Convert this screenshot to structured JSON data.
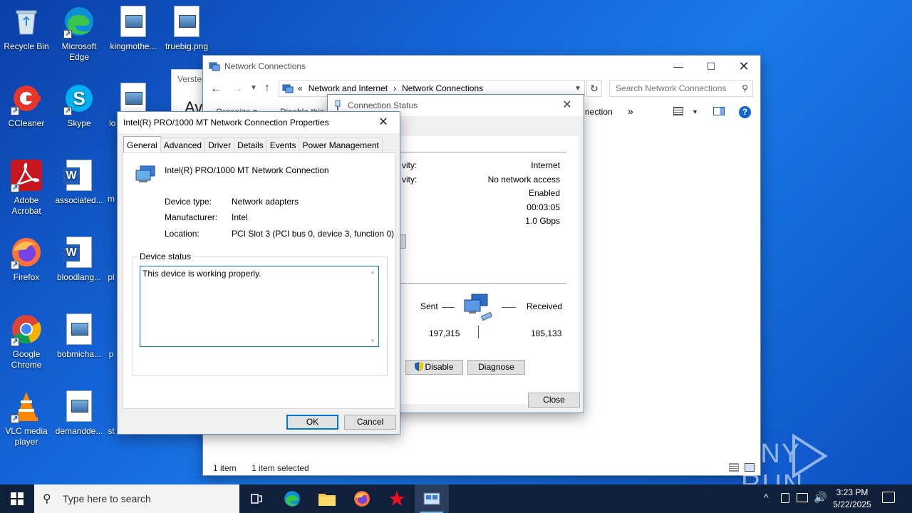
{
  "desktop": {
    "icons": [
      {
        "label": "Recycle Bin"
      },
      {
        "label": "Microsoft Edge"
      },
      {
        "label": "kingmothe..."
      },
      {
        "label": "truebig.png"
      },
      {
        "label": "CCleaner"
      },
      {
        "label": "Skype"
      },
      {
        "label": "lo"
      },
      {
        "label": "Adobe Acrobat"
      },
      {
        "label": "associated..."
      },
      {
        "label": "m"
      },
      {
        "label": "Firefox"
      },
      {
        "label": "bloodlang..."
      },
      {
        "label": "pl"
      },
      {
        "label": "Google Chrome"
      },
      {
        "label": "bobmicha..."
      },
      {
        "label": "p"
      },
      {
        "label": "VLC media player"
      },
      {
        "label": "demandde..."
      },
      {
        "label": "st"
      }
    ],
    "watermark": "ANY RUN"
  },
  "bg_window": {
    "tab_text": "Versted",
    "big_text": "Av",
    "organize": "Organize ▾",
    "disable": "Disable this"
  },
  "network_connections": {
    "title": "Network Connections",
    "breadcrumb": [
      "«",
      "Network and Internet",
      "›",
      "Network Connections"
    ],
    "search_placeholder": "Search Network Connections",
    "toolbar_partial": "nection",
    "toolbar_more": "»",
    "status_items": "1 item",
    "status_selected": "1 item selected"
  },
  "connection_status": {
    "title": "Connection Status",
    "rows": [
      {
        "label": "vity:",
        "value": "Internet"
      },
      {
        "label": "vity:",
        "value": "No network access"
      },
      {
        "label": "",
        "value": "Enabled"
      },
      {
        "label": "",
        "value": "00:03:05"
      },
      {
        "label": "",
        "value": "1.0 Gbps"
      }
    ],
    "sent_label": "Sent",
    "received_label": "Received",
    "sent_value": "197,315",
    "received_value": "185,133",
    "disable_button": "Disable",
    "diagnose_button": "Diagnose",
    "close_button": "Close"
  },
  "properties": {
    "title": "Intel(R) PRO/1000 MT Network Connection Properties",
    "tabs": [
      "General",
      "Advanced",
      "Driver",
      "Details",
      "Events",
      "Power Management"
    ],
    "device_name": "Intel(R) PRO/1000 MT Network Connection",
    "device_type_label": "Device type:",
    "device_type_value": "Network adapters",
    "manufacturer_label": "Manufacturer:",
    "manufacturer_value": "Intel",
    "location_label": "Location:",
    "location_value": "PCI Slot 3 (PCI bus 0, device 3, function 0)",
    "device_status_legend": "Device status",
    "device_status_text": "This device is working properly.",
    "ok_button": "OK",
    "cancel_button": "Cancel"
  },
  "taskbar": {
    "search_placeholder": "Type here to search",
    "time": "3:23 PM",
    "date": "5/22/2025"
  }
}
